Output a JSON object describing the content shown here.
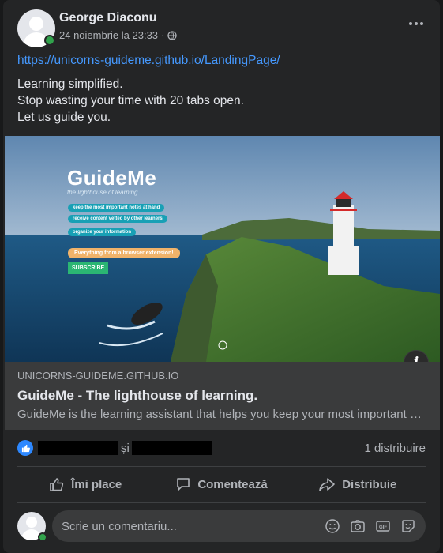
{
  "post": {
    "author": "George Diaconu",
    "timestamp": "24 noiembrie la 23:33",
    "separator": "·",
    "privacy_icon": "globe-icon",
    "link_url": "https://unicorns-guideme.github.io/LandingPage/",
    "lines": [
      "Learning simplified.",
      "Stop wasting your time with 20 tabs open.",
      "Let us guide you."
    ]
  },
  "preview": {
    "image": {
      "brand": "GuideMe",
      "tagline": "the lighthouse of learning",
      "features": [
        "keep the most important notes at hand",
        "receive content vetted by other learners",
        "organize your information"
      ],
      "extension_note": "Everything from a browser extension!",
      "subscribe": "SUBSCRIBE"
    },
    "domain": "UNICORNS-GUIDEME.GITHUB.IO",
    "title": "GuideMe - The lighthouse of learning.",
    "description": "GuideMe is the learning assistant that helps you keep your most important notes at hand"
  },
  "reactions": {
    "connector": "și",
    "shares": "1 distribuire"
  },
  "actions": {
    "like": "Îmi place",
    "comment": "Comentează",
    "share": "Distribuie"
  },
  "composer": {
    "placeholder": "Scrie un comentariu...",
    "icons": [
      "emoji-icon",
      "camera-icon",
      "gif-icon",
      "sticker-icon"
    ]
  },
  "colors": {
    "accent": "#2d88ff",
    "link": "#4599ff",
    "online": "#31a24c",
    "card": "#242526"
  }
}
